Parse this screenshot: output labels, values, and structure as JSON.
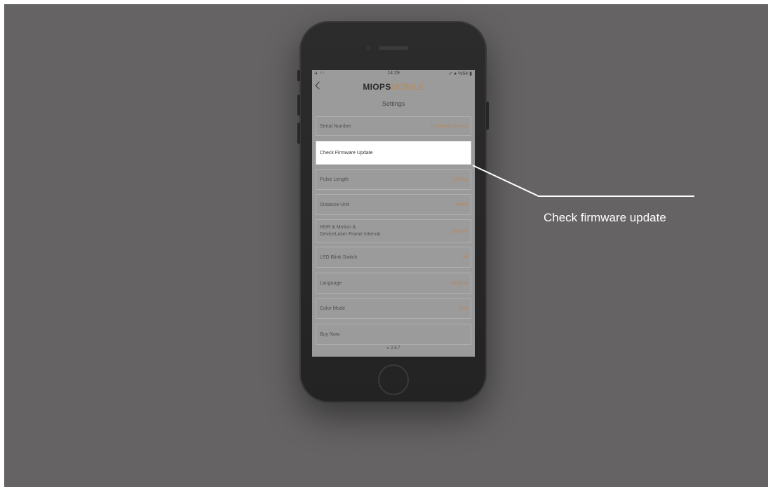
{
  "status_bar": {
    "time": "14:29",
    "left": "✈ ◠",
    "right": "➶ ● %54 ▮"
  },
  "app": {
    "logo_bold": "MIOPS",
    "logo_light": "MOBILE",
    "page_title": "Settings"
  },
  "settings": [
    {
      "label": "Serial Number",
      "value": "Unknown Device"
    },
    {
      "label": "Check Firmware Update",
      "value": ""
    },
    {
      "label": "Pulse Length",
      "value": "250ms"
    },
    {
      "label": "Distance Unit",
      "value": "Feets"
    },
    {
      "label_line1": "HDR & Motion &",
      "label_line2": "DeviceLaser Frame Interval",
      "value": "1000ms"
    },
    {
      "label": "LED Blink Switch",
      "value": "Off"
    },
    {
      "label": "Language",
      "value": "English"
    },
    {
      "label": "Color Mode",
      "value": "Day"
    },
    {
      "label": "Buy Now",
      "value": ""
    }
  ],
  "version": "v. 2.8.7",
  "callout": {
    "text": "Check firmware update"
  }
}
